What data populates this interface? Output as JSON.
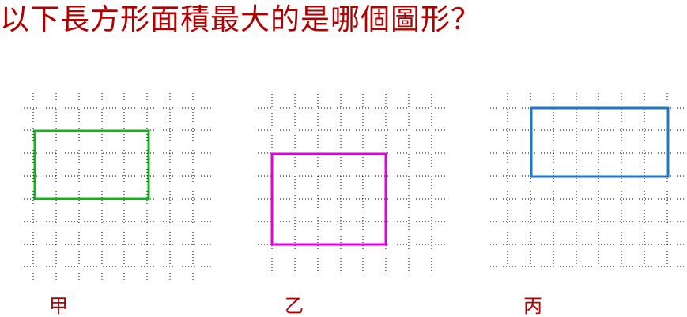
{
  "question": "以下長方形面積最大的是哪個圖形？",
  "colors": {
    "text": "#b00000",
    "grid": "#000000"
  },
  "panels": [
    {
      "label": "甲",
      "rect_color": "#1ab21a"
    },
    {
      "label": "乙",
      "rect_color": "#e000e0"
    },
    {
      "label": "丙",
      "rect_color": "#1e78c8"
    }
  ]
}
